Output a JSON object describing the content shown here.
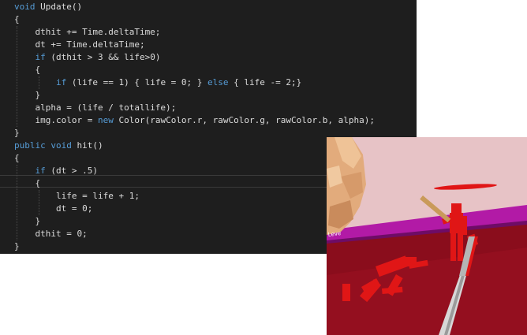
{
  "code": {
    "lines": [
      [
        {
          "t": "void",
          "k": "kw"
        },
        {
          "t": " Update()",
          "k": "plain"
        }
      ],
      [
        {
          "t": "{",
          "k": "plain"
        }
      ],
      [
        {
          "t": "    dthit += Time.deltaTime;",
          "k": "plain"
        }
      ],
      [
        {
          "t": "    dt += Time.deltaTime;",
          "k": "plain"
        }
      ],
      [
        {
          "t": "    if",
          "k": "kw"
        },
        {
          "t": " (dthit > 3 && life>0)",
          "k": "plain"
        }
      ],
      [
        {
          "t": "    {",
          "k": "plain"
        }
      ],
      [
        {
          "t": "        if",
          "k": "kw"
        },
        {
          "t": " (life == 1) { life = 0; } ",
          "k": "plain"
        },
        {
          "t": "else",
          "k": "kw"
        },
        {
          "t": " { life -= 2;}",
          "k": "plain"
        }
      ],
      [
        {
          "t": "    }",
          "k": "plain"
        }
      ],
      [
        {
          "t": "    alpha = (life / totallife);",
          "k": "plain"
        }
      ],
      [
        {
          "t": "    img.color = ",
          "k": "plain"
        },
        {
          "t": "new",
          "k": "kw"
        },
        {
          "t": " Color(rawColor.r, rawColor.g, rawColor.b, alpha);",
          "k": "plain"
        }
      ],
      [
        {
          "t": "}",
          "k": "plain"
        }
      ],
      [
        {
          "t": "public",
          "k": "kw"
        },
        {
          "t": " ",
          "k": "plain"
        },
        {
          "t": "void",
          "k": "kw"
        },
        {
          "t": " hit()",
          "k": "plain"
        }
      ],
      [
        {
          "t": "{",
          "k": "plain"
        }
      ],
      [
        {
          "t": "    if",
          "k": "kw"
        },
        {
          "t": " (dt > .5)",
          "k": "plain"
        }
      ],
      [
        {
          "t": "    {",
          "k": "plain"
        }
      ],
      [
        {
          "t": "        life = life + 1;",
          "k": "plain"
        }
      ],
      [
        {
          "t": "        dt = 0;",
          "k": "plain"
        }
      ],
      [
        {
          "t": "    }",
          "k": "plain"
        }
      ],
      [
        {
          "t": "    dthit = 0;",
          "k": "plain"
        }
      ],
      [
        {
          "t": "}",
          "k": "plain"
        }
      ]
    ],
    "colors": {
      "keyword": "#569cd6",
      "text": "#dcdcdc",
      "background": "#1e1e1e"
    }
  },
  "game_view": {
    "wall_label": "Leve",
    "colors": {
      "sky": "#e7c3c6",
      "floor": "#8a0d1c",
      "magenta_wall": "#b21aa6",
      "figure": "#e01616",
      "pillar": "#e0a878"
    }
  }
}
